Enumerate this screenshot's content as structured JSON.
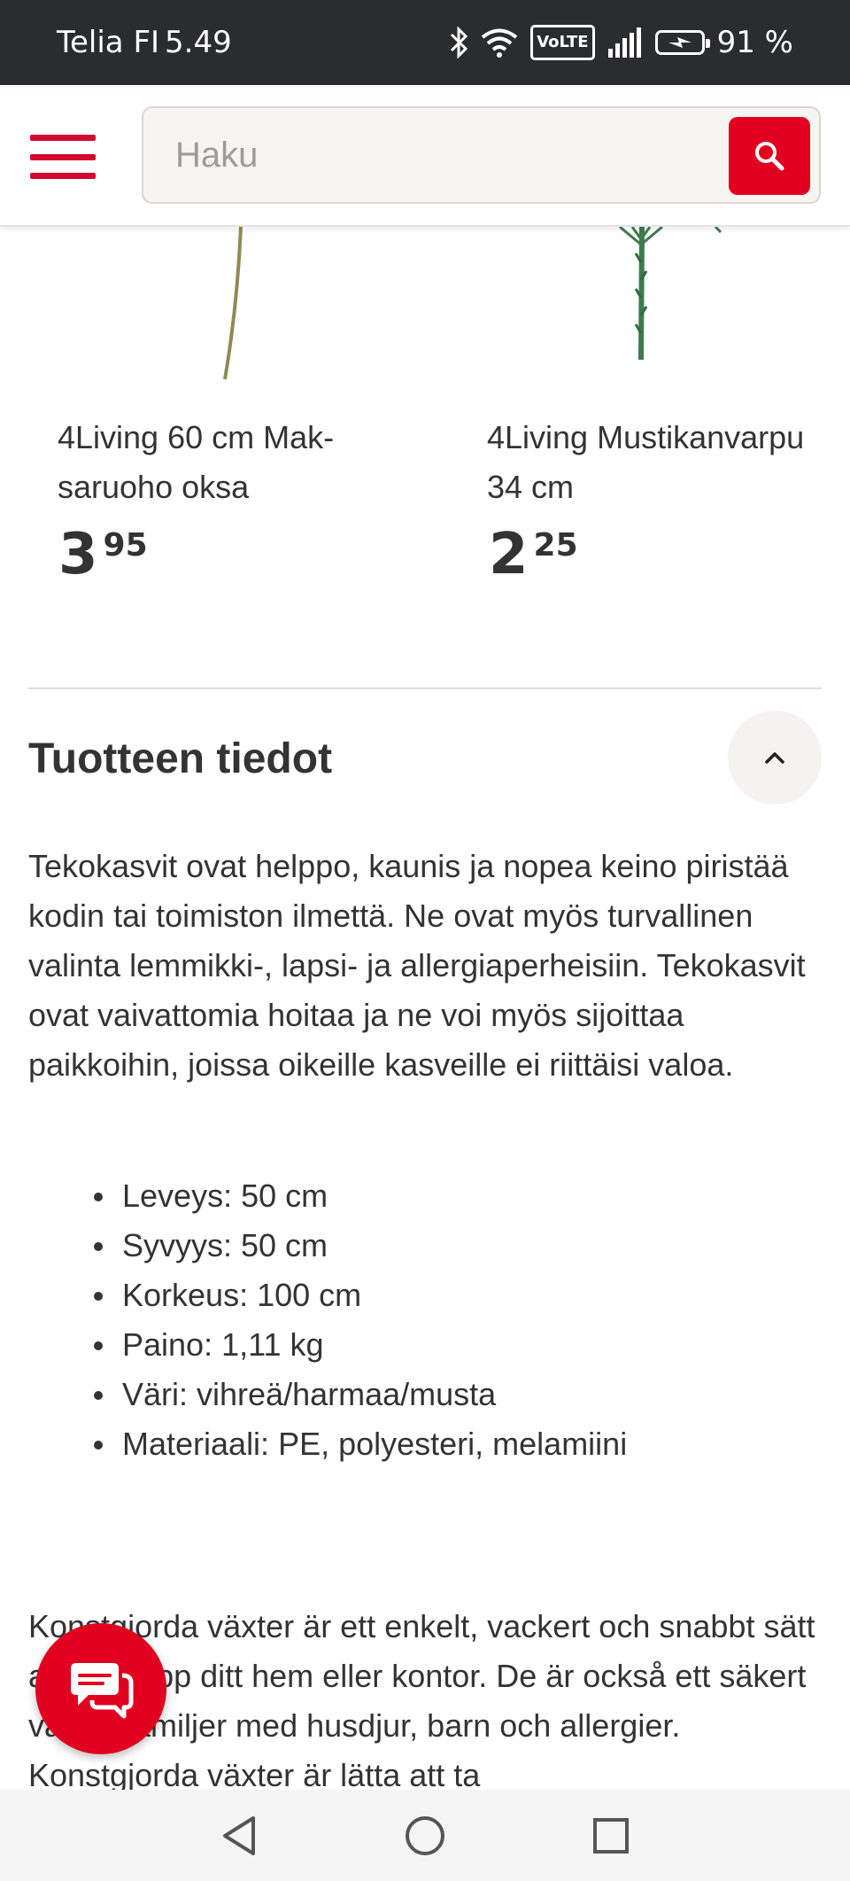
{
  "status_bar": {
    "carrier": "Telia FI",
    "time": "5.49",
    "network_badge": "VoLTE",
    "battery_percent": "91 %",
    "icons": [
      "bluetooth-icon",
      "wifi-icon",
      "volte-icon",
      "signal-icon",
      "battery-charging-icon"
    ]
  },
  "header": {
    "search": {
      "placeholder": "Haku",
      "value": ""
    },
    "menu_icon": "hamburger-icon",
    "search_icon": "magnifier-icon",
    "accent_color": "#e1001f"
  },
  "products": [
    {
      "name": "4Living 60 cm Mak­saruoho oksa",
      "price_main": "3",
      "price_cents": "95"
    },
    {
      "name": "4Living Mustikan­varpu 34 cm",
      "price_main": "2",
      "price_cents": "25"
    }
  ],
  "details": {
    "title": "Tuotteen tiedot",
    "toggle_icon": "chevron-up-icon",
    "description": "Tekokasvit ovat helppo, kaunis ja nopea keino piristää kodin tai toimiston ilmettä. Ne ovat myös turvallinen valinta lemmikki-, lapsi- ja allergiaperheisiin. Tekokasvit ovat vaivattomia hoitaa ja ne voi myös sijoittaa paikkoihin, joissa oikeille kasveille ei riittäisi valoa.",
    "specs": [
      "Leveys: 50 cm",
      "Syvyys: 50 cm",
      "Korkeus: 100 cm",
      "Paino: 1,11 kg",
      "Väri: vihreä/harmaa/musta",
      "Materiaali: PE, polyesteri, melamiini"
    ],
    "description_sv": "Konstgjorda växter är ett enkelt, vackert och snabbt sätt att lysa upp ditt hem eller kontor. De är också ett säkert val för familjer med husdjur, barn och allergier. Konstgjorda växter är lätta att ta"
  },
  "chat": {
    "icon": "chat-bubbles-icon"
  },
  "nav_bar": {
    "icons": [
      "back-triangle-icon",
      "home-circle-icon",
      "recents-square-icon"
    ]
  }
}
